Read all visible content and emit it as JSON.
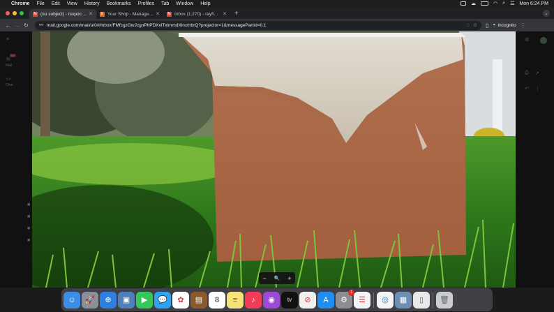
{
  "menubar": {
    "app_name": "Chrome",
    "items": [
      "File",
      "Edit",
      "View",
      "History",
      "Bookmarks",
      "Profiles",
      "Tab",
      "Window",
      "Help"
    ],
    "clock": "Mon 6:24 PM"
  },
  "tabs": [
    {
      "title": "(no subject) - rsvpocq3@gm",
      "favicon": "gmail-icon",
      "color": "#ea4335",
      "active": true
    },
    {
      "title": "Your Shop - Manage Listings",
      "favicon": "etsy-icon",
      "color": "#f1641e",
      "active": false
    },
    {
      "title": "Inbox (1,270) - rayfield@thm",
      "favicon": "gmail-icon",
      "color": "#ea4335",
      "active": false
    }
  ],
  "toolbar": {
    "url": "mail.google.com/mail/u/0/#inbox/FMfcgzGwJcgnPhPDXvlTxlmmdXlnxmbrQ?projector=1&messagePartId=0.1",
    "incognito_label": "Incognito"
  },
  "gmail_bg": {
    "mail_label": "Mail",
    "chat_label": "Chat",
    "unread_badge": "99+"
  },
  "viewer": {
    "zoom_out": "−",
    "zoom_reset": "🔍",
    "zoom_in": "+"
  },
  "dock": {
    "apps": [
      {
        "name": "finder-icon",
        "bg": "#3a8ee6",
        "glyph": "☺"
      },
      {
        "name": "launchpad-icon",
        "bg": "#8a8f99",
        "glyph": "🚀"
      },
      {
        "name": "safari-icon",
        "bg": "#2d7fe0",
        "glyph": "⊕"
      },
      {
        "name": "preview-icon",
        "bg": "#4d7fb8",
        "glyph": "▣"
      },
      {
        "name": "facetime-icon",
        "bg": "#35c759",
        "glyph": "▶"
      },
      {
        "name": "messages-icon",
        "bg": "#2ea3f2",
        "glyph": "💬"
      },
      {
        "name": "photos-icon",
        "bg": "#ffffff",
        "glyph": "✿"
      },
      {
        "name": "notebook-icon",
        "bg": "#8b5a2b",
        "glyph": "▤"
      },
      {
        "name": "calendar-icon",
        "bg": "#ffffff",
        "glyph": "8"
      },
      {
        "name": "notes-icon",
        "bg": "#f7e27a",
        "glyph": "≡"
      },
      {
        "name": "music-icon",
        "bg": "#f23d5a",
        "glyph": "♪"
      },
      {
        "name": "podcasts-icon",
        "bg": "#9b4ad8",
        "glyph": "◉"
      },
      {
        "name": "apple-tv-icon",
        "bg": "#111111",
        "glyph": "tv"
      },
      {
        "name": "news-icon",
        "bg": "#f0f0f0",
        "glyph": "⊘"
      },
      {
        "name": "app-store-icon",
        "bg": "#1f8ef1",
        "glyph": "A"
      },
      {
        "name": "system-settings-icon",
        "bg": "#8d8d92",
        "glyph": "⚙"
      },
      {
        "name": "reminders-icon",
        "bg": "#f4f4f4",
        "glyph": "☰"
      },
      {
        "name": "chrome-icon",
        "bg": "#f4f4f4",
        "glyph": "◎"
      },
      {
        "name": "image-capture-icon",
        "bg": "#6e8fb5",
        "glyph": "▦"
      },
      {
        "name": "documents-icon",
        "bg": "#e9e9e9",
        "glyph": "▯"
      },
      {
        "name": "trash-icon",
        "bg": "#c9ccd1",
        "glyph": "🗑"
      }
    ],
    "calendar_day": "8",
    "settings_badge": "1"
  }
}
